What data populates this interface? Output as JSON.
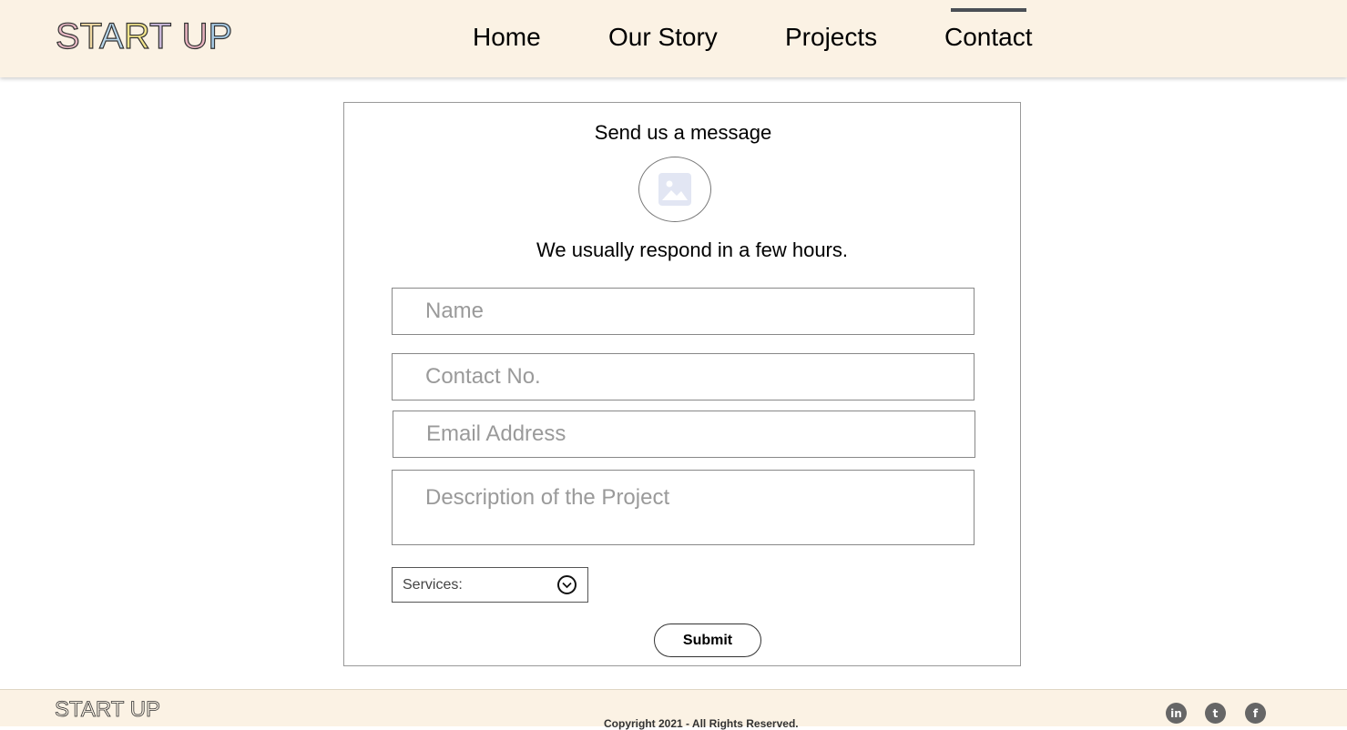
{
  "header": {
    "logo_letters": [
      "S",
      "T",
      "A",
      "R",
      "T",
      " ",
      "U",
      "P"
    ],
    "logo_colors": [
      "#e7b8c3",
      "#f0d9a3",
      "#b7d5e9",
      "#f2e48a",
      "#c9b7d9",
      "",
      "#e8b3c0",
      "#a9cde7"
    ],
    "nav": [
      {
        "label": "Home"
      },
      {
        "label": "Our Story"
      },
      {
        "label": "Projects"
      },
      {
        "label": "Contact",
        "active": true
      }
    ]
  },
  "form": {
    "title": "Send us a message",
    "subtitle": "We usually respond in a few hours.",
    "name_placeholder": "Name",
    "contact_placeholder": "Contact No.",
    "email_placeholder": "Email Address",
    "description_placeholder": "Description of the Project",
    "services_label": "Services:",
    "submit_label": "Submit"
  },
  "footer": {
    "logo_text": "START UP",
    "copyright": "Copyright 2021 - All Rights Reserved.",
    "social": [
      {
        "icon": "linkedin-icon",
        "glyph": "in"
      },
      {
        "icon": "twitter-icon",
        "glyph": "t"
      },
      {
        "icon": "facebook-icon",
        "glyph": "f"
      }
    ]
  }
}
